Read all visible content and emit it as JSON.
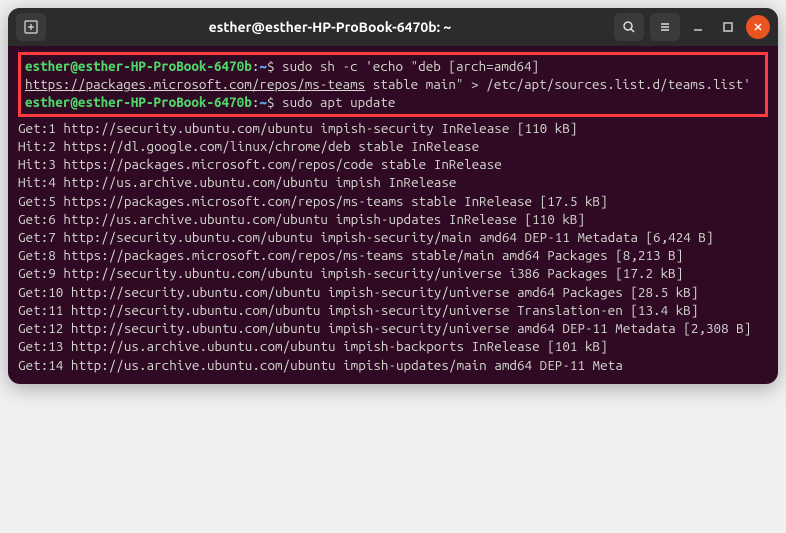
{
  "titlebar": {
    "title": "esther@esther-HP-ProBook-6470b: ~"
  },
  "prompt": {
    "user_host": "esther@esther-HP-ProBook-6470b",
    "sep1": ":",
    "path": "~",
    "sep2": "$"
  },
  "cmd1": {
    "pre": " sudo sh -c 'echo \"deb [arch=amd64] ",
    "url": "https://packages.microsoft.com/repos/ms-teams",
    "post": " stable main\" > /etc/apt/sources.list.d/teams.list'"
  },
  "cmd2": " sudo apt update",
  "output": [
    "Get:1 http://security.ubuntu.com/ubuntu impish-security InRelease [110 kB]",
    "Hit:2 https://dl.google.com/linux/chrome/deb stable InRelease",
    "Hit:3 https://packages.microsoft.com/repos/code stable InRelease",
    "Hit:4 http://us.archive.ubuntu.com/ubuntu impish InRelease",
    "Get:5 https://packages.microsoft.com/repos/ms-teams stable InRelease [17.5 kB]",
    "Get:6 http://us.archive.ubuntu.com/ubuntu impish-updates InRelease [110 kB]",
    "Get:7 http://security.ubuntu.com/ubuntu impish-security/main amd64 DEP-11 Metadata [6,424 B]",
    "Get:8 https://packages.microsoft.com/repos/ms-teams stable/main amd64 Packages [8,213 B]",
    "Get:9 http://security.ubuntu.com/ubuntu impish-security/universe i386 Packages [17.2 kB]",
    "Get:10 http://security.ubuntu.com/ubuntu impish-security/universe amd64 Packages [28.5 kB]",
    "Get:11 http://security.ubuntu.com/ubuntu impish-security/universe Translation-en [13.4 kB]",
    "Get:12 http://security.ubuntu.com/ubuntu impish-security/universe amd64 DEP-11 Metadata [2,308 B]",
    "Get:13 http://us.archive.ubuntu.com/ubuntu impish-backports InRelease [101 kB]",
    "Get:14 http://us.archive.ubuntu.com/ubuntu impish-updates/main amd64 DEP-11 Meta"
  ]
}
